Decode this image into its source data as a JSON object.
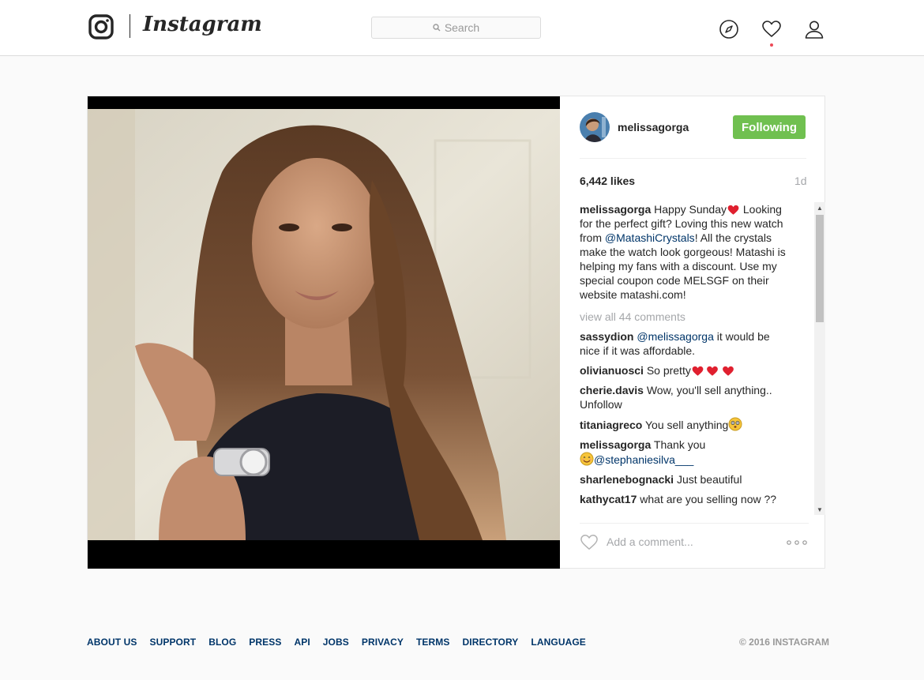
{
  "header": {
    "wordmark": "Instagram",
    "search_placeholder": "Search",
    "notification_dot_color": "#ed4956"
  },
  "icons": {
    "logo": "instagram-camera-icon",
    "search": "magnifier-icon",
    "explore": "compass-icon",
    "activity": "heart-icon",
    "profile": "person-icon",
    "like": "heart-outline-icon",
    "more": "ellipsis-icon"
  },
  "post": {
    "author": "melissagorga",
    "follow_label": "Following",
    "follow_color": "#70c050",
    "likes": "6,442 likes",
    "time": "1d",
    "caption": {
      "user": "melissagorga",
      "text_1": "Happy Sunday",
      "text_2": " Looking for the perfect gift? Loving this new watch from ",
      "mention": "@MatashiCrystals",
      "text_3": "! All the crystals make the watch look gorgeous! Matashi is helping my fans with a discount. Use my special coupon code MELSGF on their website matashi.com!"
    },
    "view_all": "view all 44 comments",
    "comments": [
      {
        "user": "sassydion",
        "mention": "@melissagorga",
        "text": " it would be nice if it was affordable."
      },
      {
        "user": "olivianuosci",
        "text": "So pretty"
      },
      {
        "user": "cherie.davis",
        "text": "Wow, you'll sell anything.. Unfollow"
      },
      {
        "user": "titaniagreco",
        "text": "You sell anything"
      },
      {
        "user": "melissagorga",
        "text": "Thank you ",
        "mention": "@stephaniesilva___"
      },
      {
        "user": "sharlenebognacki",
        "text": "Just beautiful"
      },
      {
        "user": "kathycat17",
        "text": "what are you selling now ??"
      }
    ],
    "add_comment_placeholder": "Add a comment..."
  },
  "footer": {
    "links": [
      "ABOUT US",
      "SUPPORT",
      "BLOG",
      "PRESS",
      "API",
      "JOBS",
      "PRIVACY",
      "TERMS",
      "DIRECTORY",
      "LANGUAGE"
    ],
    "copyright": "© 2016 INSTAGRAM"
  }
}
